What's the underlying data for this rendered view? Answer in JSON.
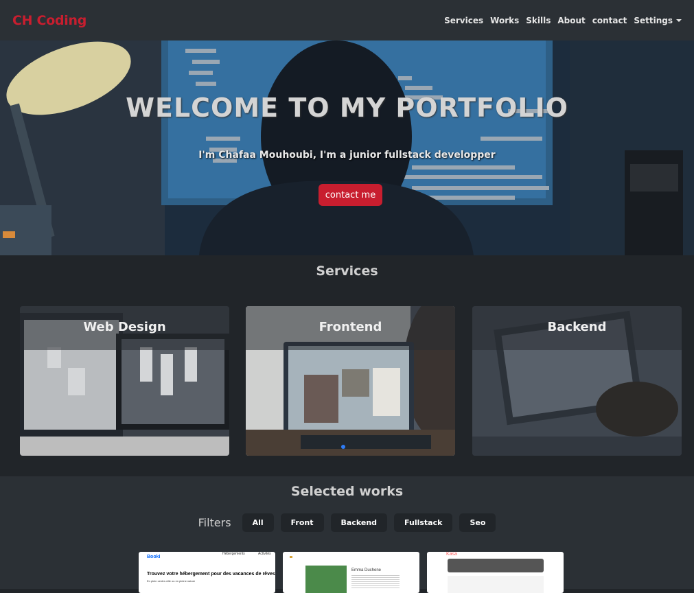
{
  "brand": "CH Coding",
  "nav": {
    "items": [
      "Services",
      "Works",
      "Skills",
      "About",
      "contact"
    ],
    "settings": "Settings"
  },
  "hero": {
    "title": "WELCOME TO MY PORTFOLIO",
    "subtitle": "I'm Chafaa Mouhoubi, I'm a junior fullstack developper",
    "button": "contact me"
  },
  "services": {
    "title": "Services",
    "cards": [
      "Web Design",
      "Frontend",
      "Backend"
    ]
  },
  "works": {
    "title": "Selected works",
    "filters_label": "Filters",
    "filters": [
      "All",
      "Front",
      "Backend",
      "Fullstack",
      "Seo"
    ],
    "thumb1": {
      "brand": "Booki",
      "nav1": "Hébergements",
      "nav2": "Activités",
      "heading": "Trouvez votre hébergement pour des vacances de rêves",
      "sub": "En plein centre-ville ou en pleine nature"
    },
    "thumb2": {
      "heading": "Emma Duchene"
    },
    "thumb3": {
      "brand": "Kasa"
    }
  },
  "colors": {
    "accent": "#c81e2f",
    "navbar": "#2b3035",
    "background": "#212529"
  }
}
